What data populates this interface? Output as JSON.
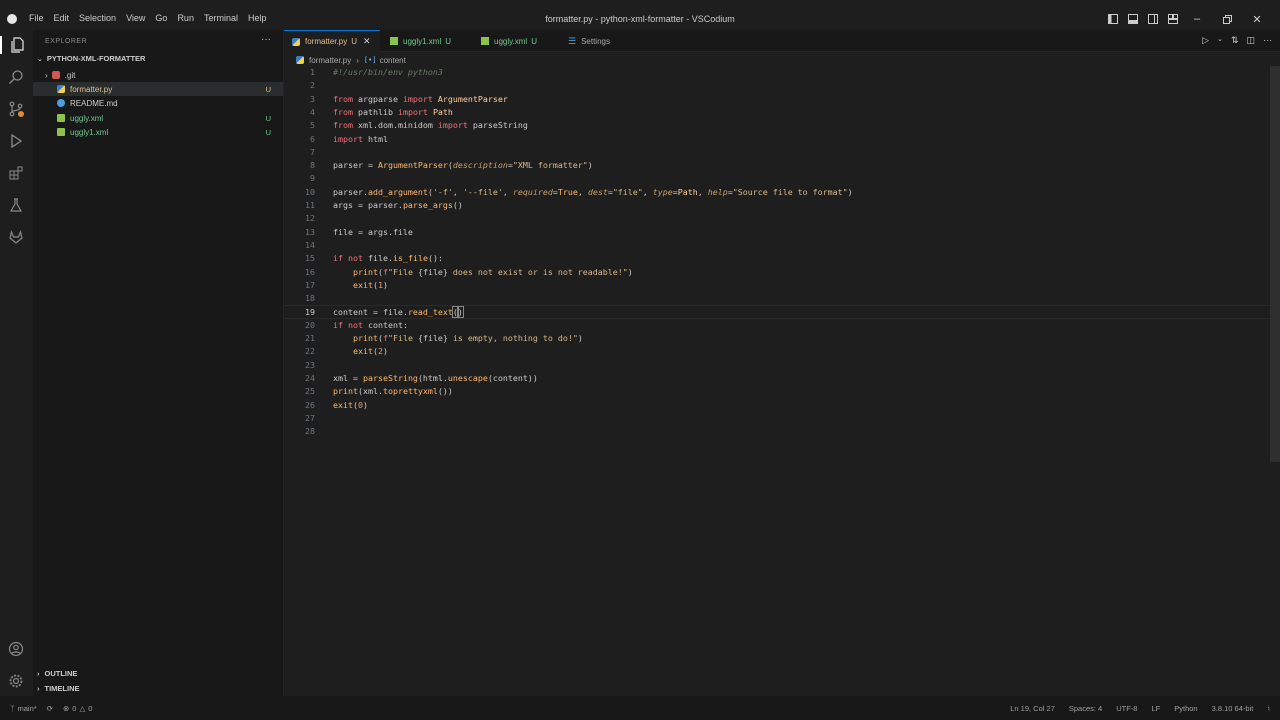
{
  "window": {
    "title": "formatter.py - python-xml-formatter - VSCodium"
  },
  "menu": [
    "File",
    "Edit",
    "Selection",
    "View",
    "Go",
    "Run",
    "Terminal",
    "Help"
  ],
  "explorer": {
    "header": "EXPLORER",
    "more_label": "···",
    "project": "PYTHON-XML-FORMATTER",
    "items": [
      {
        "name": ".git",
        "badge": "",
        "kind": "folder"
      },
      {
        "name": "formatter.py",
        "badge": "U",
        "kind": "python"
      },
      {
        "name": "README.md",
        "badge": "",
        "kind": "info"
      },
      {
        "name": "uggly.xml",
        "badge": "U",
        "kind": "xml"
      },
      {
        "name": "uggly1.xml",
        "badge": "U",
        "kind": "xml"
      }
    ],
    "outline": "OUTLINE",
    "timeline": "TIMELINE"
  },
  "tabs": [
    {
      "label": "formatter.py",
      "badge": "U",
      "active": true
    },
    {
      "label": "uggly1.xml",
      "badge": "U",
      "active": false
    },
    {
      "label": "uggly.xml",
      "badge": "U",
      "active": false
    },
    {
      "label": "Settings",
      "badge": "",
      "active": false
    }
  ],
  "breadcrumb": {
    "file": "formatter.py",
    "symbol": "content"
  },
  "code": {
    "line_numbers": [
      "1",
      "2",
      "3",
      "4",
      "5",
      "6",
      "7",
      "8",
      "9",
      "10",
      "11",
      "12",
      "13",
      "14",
      "15",
      "16",
      "17",
      "18",
      "19",
      "20",
      "21",
      "22",
      "23",
      "24",
      "25",
      "26",
      "27",
      "28"
    ],
    "current_line": 19
  },
  "status": {
    "branch": "main*",
    "errors": "0",
    "warnings": "0",
    "position": "Ln 19, Col 27",
    "spaces": "Spaces: 4",
    "encoding": "UTF-8",
    "eol": "LF",
    "language": "Python",
    "interpreter": "3.8.10 64-bit"
  },
  "colors": {
    "accent": "#0078d4",
    "untracked": "#73c991"
  }
}
